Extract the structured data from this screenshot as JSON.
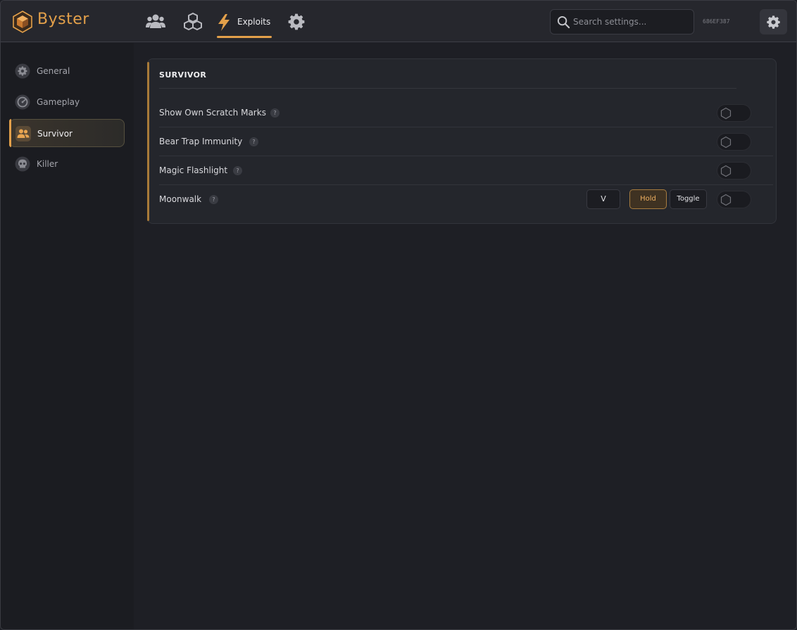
{
  "app": {
    "brand": "Byster"
  },
  "header": {
    "nav": [
      {
        "icon": "users-icon"
      },
      {
        "icon": "cubes-icon"
      },
      {
        "icon": "lightning-icon",
        "label": "Exploits",
        "active": true
      },
      {
        "icon": "gear-icon"
      }
    ],
    "search": {
      "placeholder": "Search settings..."
    },
    "hwid": "686EF387"
  },
  "sidebar": {
    "items": [
      {
        "label": "General",
        "icon": "gear-icon"
      },
      {
        "label": "Gameplay",
        "icon": "gauge-icon"
      },
      {
        "label": "Survivor",
        "icon": "users-icon",
        "active": true
      },
      {
        "label": "Killer",
        "icon": "skull-icon"
      }
    ]
  },
  "panel": {
    "title": "SURVIVOR",
    "rows": [
      {
        "label": "Show Own Scratch Marks",
        "help": "?",
        "enabled": false
      },
      {
        "label": "Bear Trap Immunity",
        "help": "?",
        "enabled": false
      },
      {
        "label": "Magic Flashlight",
        "help": "?",
        "enabled": false
      },
      {
        "label": "Moonwalk",
        "help": "?",
        "key": "V",
        "mode_hold": "Hold",
        "mode_toggle": "Toggle",
        "selected_mode": "Hold",
        "enabled": false
      }
    ]
  },
  "colors": {
    "accent": "#e3a04a",
    "background": "#1e1f25",
    "panel": "#24262c"
  }
}
